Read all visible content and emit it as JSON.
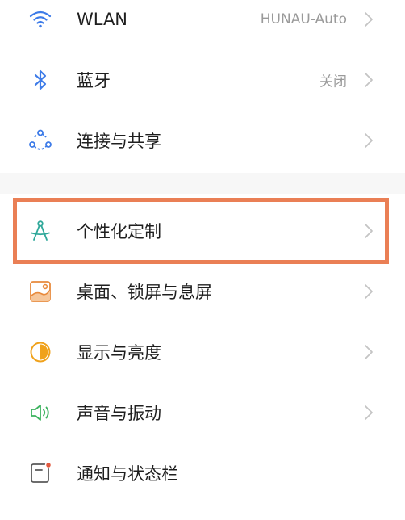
{
  "settings": {
    "items": [
      {
        "label": "WLAN",
        "value": "HUNAU-Auto",
        "icon": "wifi-icon"
      },
      {
        "label": "蓝牙",
        "value": "关闭",
        "icon": "bluetooth-icon"
      },
      {
        "label": "连接与共享",
        "value": "",
        "icon": "share-connection-icon"
      },
      {
        "label": "个性化定制",
        "value": "",
        "icon": "compass-personalize-icon",
        "highlighted": true
      },
      {
        "label": "桌面、锁屏与息屏",
        "value": "",
        "icon": "wallpaper-icon"
      },
      {
        "label": "显示与亮度",
        "value": "",
        "icon": "brightness-icon"
      },
      {
        "label": "声音与振动",
        "value": "",
        "icon": "speaker-icon"
      },
      {
        "label": "通知与状态栏",
        "value": "",
        "icon": "notification-icon"
      }
    ]
  },
  "colors": {
    "highlight_border": "#ea7f55",
    "wifi": "#3d7be8",
    "bluetooth": "#3d7be8",
    "share": "#3d7be8",
    "personalize": "#2fa89a",
    "wallpaper": "#e88a3c",
    "brightness": "#f0a21c",
    "sound": "#3db35f",
    "notification": "#e2583e"
  }
}
